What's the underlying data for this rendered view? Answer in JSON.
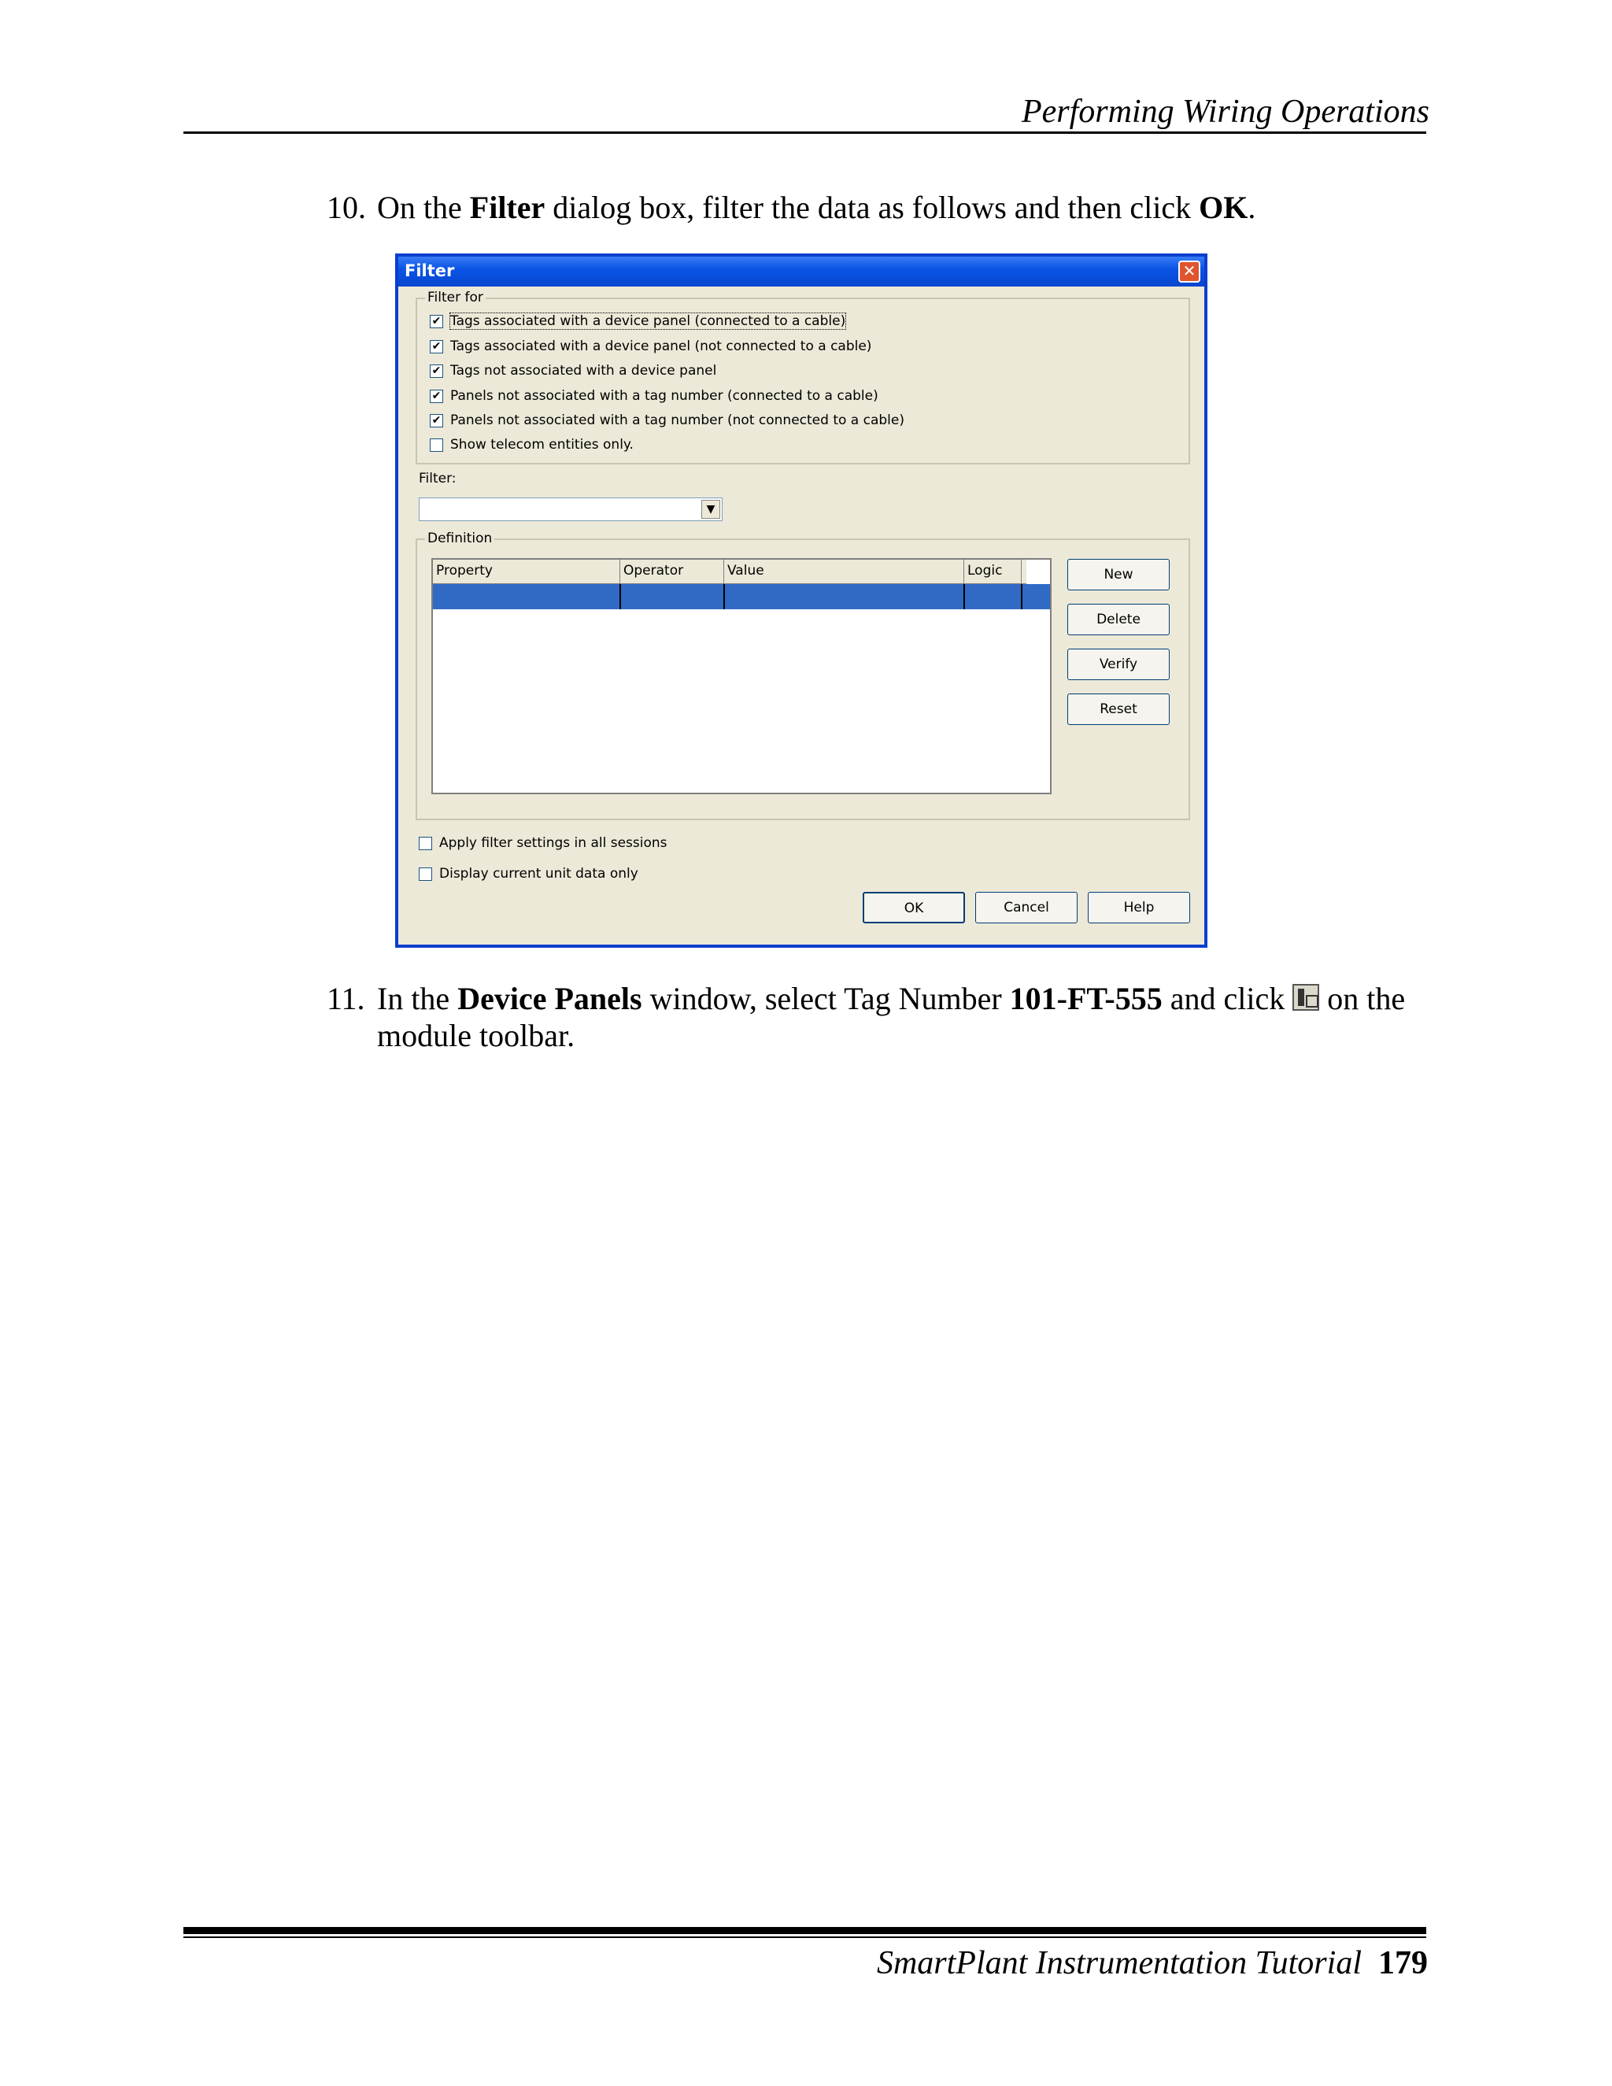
{
  "header": {
    "title": "Performing Wiring Operations"
  },
  "steps": [
    {
      "number": "10.",
      "prefix": "On the ",
      "bold1": "Filter",
      "middle": " dialog box, filter the data as follows and then click ",
      "bold2": "OK",
      "suffix": "."
    },
    {
      "number": "11.",
      "prefix": "In the ",
      "bold1": "Device Panels",
      "middle": " window, select Tag Number ",
      "bold2": "101-FT-555",
      "middle2": " and click ",
      "icon": "device-panel-toolbar-icon",
      "suffix": " on the module toolbar."
    }
  ],
  "dialog": {
    "title": "Filter",
    "close_label": "✕",
    "filter_for_label": "Filter for",
    "options": [
      {
        "label": "Tags associated with a device panel (connected to a cable)",
        "checked": true
      },
      {
        "label": "Tags associated with a device panel (not connected to a cable)",
        "checked": true
      },
      {
        "label": "Tags not associated with a device panel",
        "checked": true
      },
      {
        "label": "Panels not associated with a tag number (connected to a cable)",
        "checked": true
      },
      {
        "label": "Panels not associated with a tag number (not connected to a cable)",
        "checked": true
      },
      {
        "label": "Show telecom entities only.",
        "checked": false
      }
    ],
    "filter_label": "Filter:",
    "filter_value": "",
    "definition_label": "Definition",
    "columns": [
      "Property",
      "Operator",
      "Value",
      "Logic"
    ],
    "side_buttons": [
      "New",
      "Delete",
      "Verify",
      "Reset"
    ],
    "bottom_options": [
      {
        "label": "Apply filter settings in all sessions",
        "checked": false
      },
      {
        "label": "Display current unit data only",
        "checked": false
      }
    ],
    "buttons": {
      "ok": "OK",
      "cancel": "Cancel",
      "help": "Help"
    },
    "check_mark": "✔"
  },
  "footer": {
    "title": "SmartPlant Instrumentation Tutorial",
    "page": "179"
  },
  "colors": {
    "titlebar": "#0a55e6",
    "selection": "#316ac5",
    "dialog_bg": "#ece9d8"
  }
}
